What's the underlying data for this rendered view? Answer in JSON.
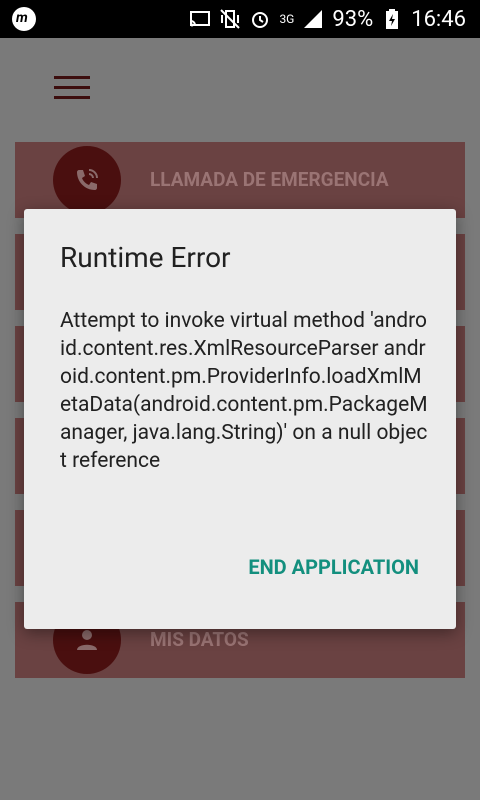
{
  "status_bar": {
    "battery": "93%",
    "network": "3G",
    "time": "16:46",
    "icons": [
      "notification-m-icon",
      "cast-icon",
      "vibrate-icon",
      "alarm-icon",
      "network-3g-icon",
      "signal-icon",
      "battery-charging-icon"
    ]
  },
  "menu": {
    "items": [
      {
        "label": "LLAMADA DE EMERGENCIA",
        "icon": "phone-call-icon"
      },
      {
        "label": "",
        "icon": ""
      },
      {
        "label": "",
        "icon": ""
      },
      {
        "label": "",
        "icon": ""
      },
      {
        "label": "",
        "icon": ""
      },
      {
        "label": "MIS DATOS",
        "icon": "person-icon"
      }
    ]
  },
  "dialog": {
    "title": "Runtime Error",
    "message": "Attempt to invoke virtual method 'android.content.res.XmlResourceParser android.content.pm.ProviderInfo.loadXmlMetaData(android.content.pm.PackageManager, java.lang.String)' on a null object reference",
    "button": "END APPLICATION"
  },
  "colors": {
    "scrim": "#7a7a7a",
    "card": "#6a4242",
    "circle": "#4a0f0f",
    "accent": "#138f7e"
  }
}
